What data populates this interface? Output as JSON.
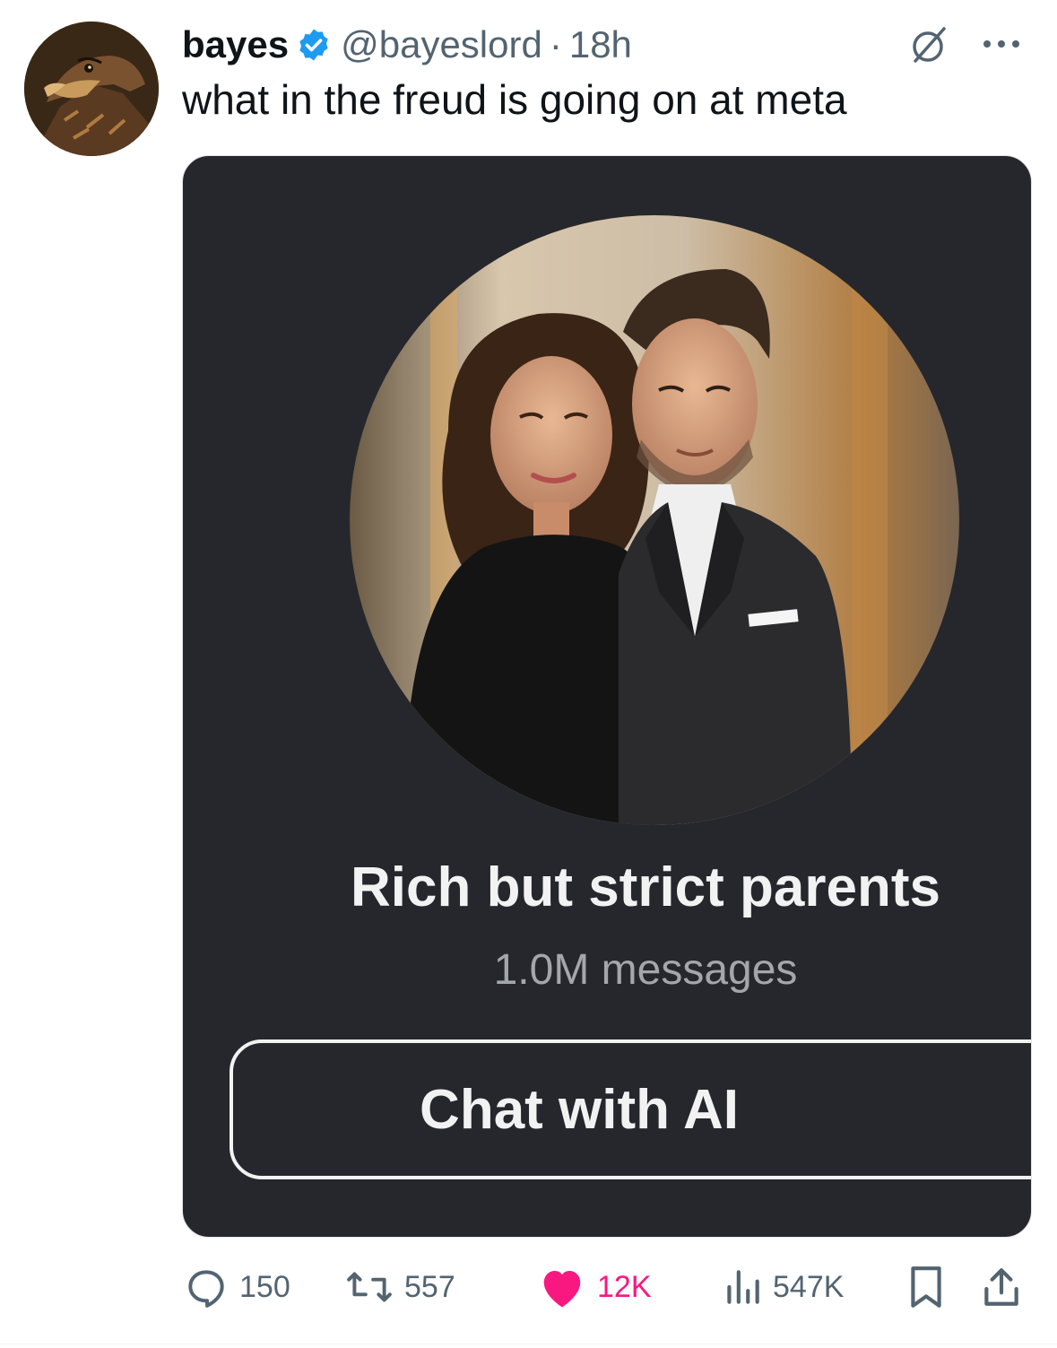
{
  "author": {
    "display_name": "bayes",
    "handle": "@bayeslord",
    "separator": "·",
    "time": "18h",
    "verified_color": "#1d9bf0"
  },
  "tweet": {
    "text": "what in the freud is going on at meta"
  },
  "media": {
    "ai_name": "Rich but strict parents",
    "ai_meta": "1.0M messages",
    "button_label": "Chat with AI"
  },
  "actions": {
    "replies": "150",
    "retweets": "557",
    "likes": "12K",
    "views": "547K",
    "like_color": "#f91880"
  },
  "icons": [
    "avatar-eagle",
    "verified-badge-icon",
    "grok-icon",
    "more-icon",
    "reply-icon",
    "retweet-icon",
    "heart-icon",
    "views-icon",
    "bookmark-icon",
    "share-icon"
  ]
}
